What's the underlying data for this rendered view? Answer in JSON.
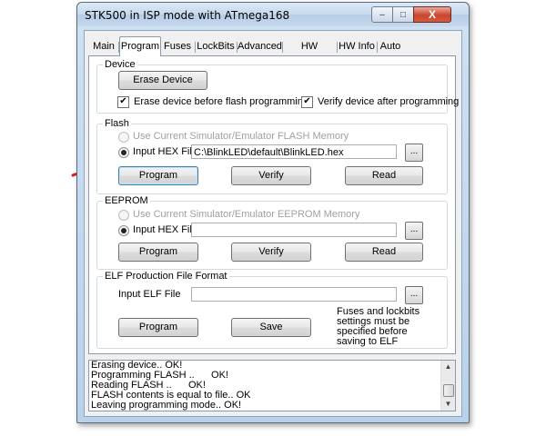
{
  "window": {
    "title": "STK500 in ISP mode with ATmega168",
    "min_glyph": "–",
    "max_glyph": "□",
    "close_glyph": "X"
  },
  "tabs": [
    "Main",
    "Program",
    "Fuses",
    "LockBits",
    "Advanced",
    "HW Settings",
    "HW Info",
    "Auto"
  ],
  "active_tab": "Program",
  "device": {
    "group_label": "Device",
    "erase_button": "Erase Device",
    "erase_before_flash": {
      "label": "Erase device before flash programming",
      "checked": true
    },
    "verify_after": {
      "label": "Verify device after programming",
      "checked": true
    }
  },
  "flash": {
    "group_label": "Flash",
    "use_simulator_label": "Use Current Simulator/Emulator FLASH Memory",
    "input_hex_label": "Input HEX File",
    "hex_path": "C:\\BlinkLED\\default\\BlinkLED.hex",
    "browse_label": "...",
    "program_button": "Program",
    "verify_button": "Verify",
    "read_button": "Read"
  },
  "eeprom": {
    "group_label": "EEPROM",
    "use_simulator_label": "Use Current Simulator/Emulator EEPROM Memory",
    "input_hex_label": "Input HEX File",
    "hex_path": "",
    "browse_label": "...",
    "program_button": "Program",
    "verify_button": "Verify",
    "read_button": "Read"
  },
  "elf": {
    "group_label": "ELF Production File Format",
    "input_label": "Input ELF File",
    "path": "",
    "browse_label": "...",
    "program_button": "Program",
    "save_button": "Save",
    "note": "Fuses and lockbits settings must be specified before saving to ELF"
  },
  "log": {
    "lines": [
      "Erasing device.. OK!",
      "Programming FLASH ..      OK!",
      "Reading FLASH ..      OK!",
      "FLASH contents is equal to file.. OK",
      "Leaving programming mode.. OK!"
    ]
  },
  "checkmark_glyph": "✔",
  "scroll_up_glyph": "▲",
  "scroll_down_glyph": "▼",
  "colors": {
    "arrow": "#e8141b",
    "window_frame": "#b9d1ea"
  }
}
